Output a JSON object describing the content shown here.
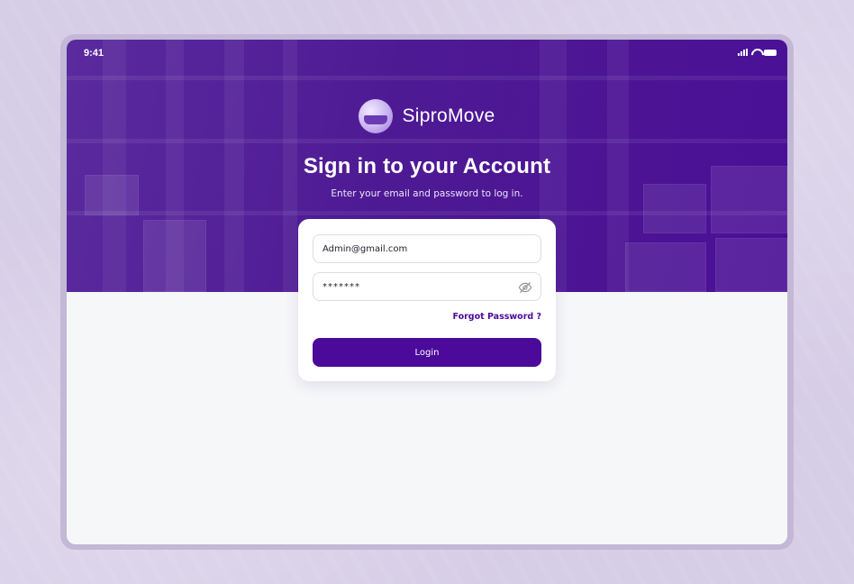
{
  "status_bar": {
    "time": "9:41"
  },
  "brand": {
    "name": "SiproMove",
    "logo_icon": "parcel-plane-logo"
  },
  "header": {
    "title": "Sign in to your Account",
    "subtitle": "Enter your email and password to log in."
  },
  "form": {
    "email_value": "Admin@gmail.com",
    "password_value": "*******",
    "password_toggle_icon": "eye-off-icon",
    "forgot_label": "Forgot Password ?",
    "login_label": "Login"
  },
  "colors": {
    "primary": "#4c0a9a",
    "hero_overlay": "#4e1a94",
    "page_background": "#d6cde6",
    "screen_background": "#f6f7f9"
  }
}
